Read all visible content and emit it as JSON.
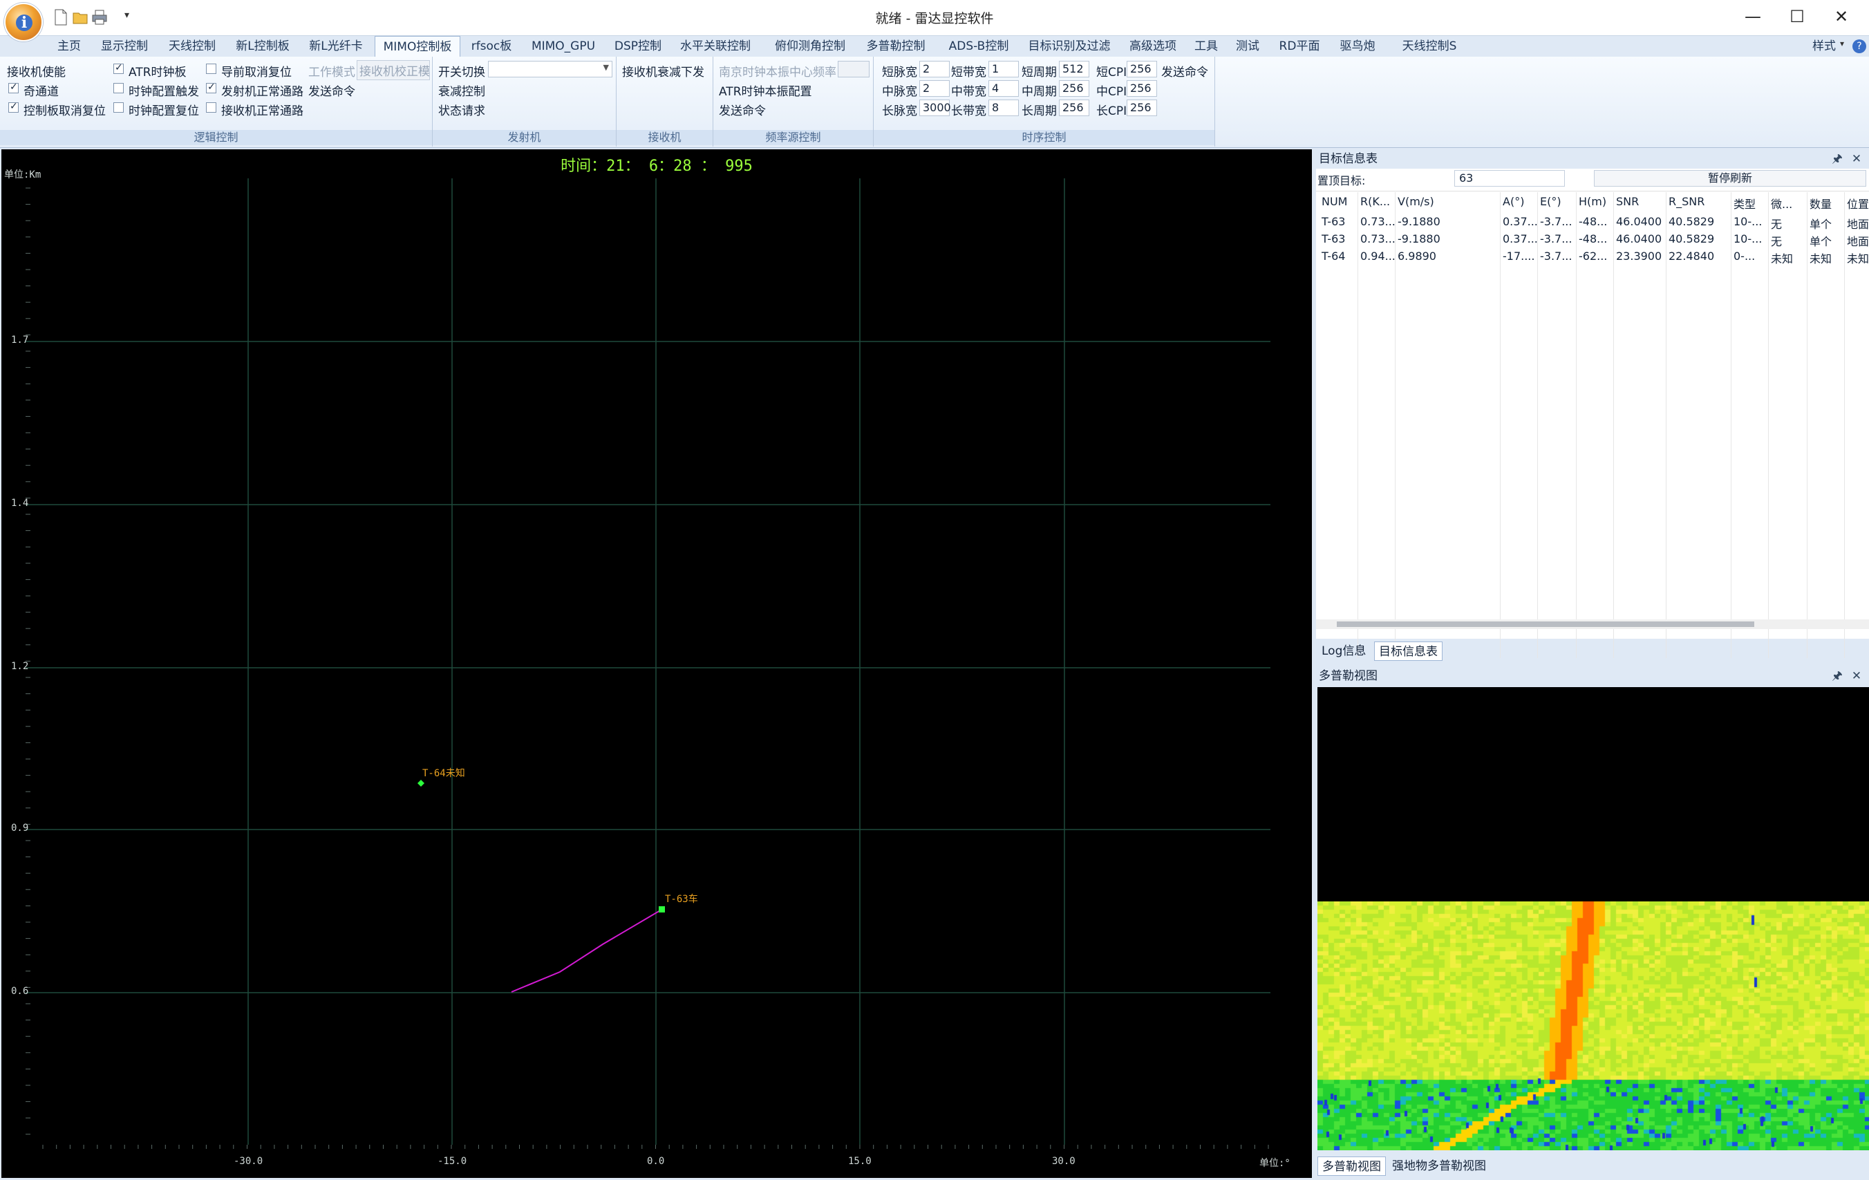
{
  "window": {
    "title": "就绪 - 雷达显控软件",
    "minimize": "—",
    "maximize": "☐",
    "close": "✕"
  },
  "tabs": [
    "主页",
    "显示控制",
    "天线控制",
    "新L控制板",
    "新L光纤卡",
    "MIMO控制板",
    "rfsoc板",
    "MIMO_GPU",
    "DSP控制",
    "水平关联控制",
    "俯仰测角控制",
    "多普勒控制",
    "ADS-B控制",
    "目标识别及过滤",
    "高级选项",
    "工具",
    "测试",
    "RD平面",
    "驱鸟炮",
    "天线控制S"
  ],
  "active_tab": "MIMO控制板",
  "style_menu": "样式",
  "ribbon": {
    "logic": {
      "label": "逻辑控制",
      "rx_enable": "接收机使能",
      "odd_channel": "奇通道",
      "ctrl_cancel_reset": "控制板取消复位",
      "atr_clock": "ATR时钟板",
      "clock_trigger": "时钟配置触发",
      "clock_reset": "时钟配置复位",
      "nav_cancel_reset": "导前取消复位",
      "tx_normal": "发射机正常通路",
      "rx_normal": "接收机正常通路",
      "work_mode": "工作模式",
      "rx_calib": "接收机校正模",
      "send_cmd": "发送命令"
    },
    "tx": {
      "label": "发射机",
      "switch": "开关切换",
      "atten": "衰减控制",
      "status": "状态请求"
    },
    "rx": {
      "label": "接收机",
      "atten_send": "接收机衰减下发"
    },
    "freq": {
      "label": "频率源控制",
      "nanjing": "南京时钟本振中心频率",
      "atr_lo": "ATR时钟本振配置",
      "send": "发送命令"
    },
    "timing": {
      "label": "时序控制",
      "short_pw": "短脉宽",
      "short_pw_v": "2",
      "mid_pw": "中脉宽",
      "mid_pw_v": "2",
      "long_pw": "长脉宽",
      "long_pw_v": "3000",
      "short_bw": "短带宽",
      "short_bw_v": "1",
      "mid_bw": "中带宽",
      "mid_bw_v": "4",
      "long_bw": "长带宽",
      "long_bw_v": "8",
      "short_pd": "短周期",
      "short_pd_v": "512",
      "mid_pd": "中周期",
      "mid_pd_v": "256",
      "long_pd": "长周期",
      "long_pd_v": "256",
      "short_cpi": "短CPI",
      "short_cpi_v": "256",
      "mid_cpi": "中CPI",
      "mid_cpi_v": "256",
      "long_cpi": "长CPI",
      "long_cpi_v": "256",
      "send": "发送命令"
    }
  },
  "radar": {
    "time": "时间：21： 6：28 ： 995",
    "unit_y": "单位:Km",
    "unit_x": "单位:°",
    "y_ticks": [
      "1.7",
      "1.4",
      "1.2",
      "0.9",
      "0.6"
    ],
    "x_ticks": [
      "-30.0",
      "-15.0",
      "0.0",
      "15.0",
      "30.0"
    ],
    "targets": [
      {
        "label": "T-64未知"
      },
      {
        "label": "T-63车"
      }
    ]
  },
  "target_table": {
    "header": "目标信息表",
    "top_label": "置顶目标:",
    "top_value": "63",
    "pause_btn": "暂停刷新",
    "columns": [
      "NUM",
      "R(K...",
      "V(m/s)",
      "A(°)",
      "E(°)",
      "H(m)",
      "SNR",
      "R_SNR",
      "类型",
      "微...",
      "数量",
      "位置"
    ],
    "rows": [
      [
        "T-63",
        "0.73...",
        "-9.1880",
        "0.37...",
        "-3.7...",
        "-48...",
        "46.0400",
        "40.5829",
        "10-...",
        "无",
        "单个",
        "地面"
      ],
      [
        "T-63",
        "0.73...",
        "-9.1880",
        "0.37...",
        "-3.7...",
        "-48...",
        "46.0400",
        "40.5829",
        "10-...",
        "无",
        "单个",
        "地面"
      ],
      [
        "T-64",
        "0.94...",
        "6.9890",
        "-17....",
        "-3.7...",
        "-62...",
        "23.3900",
        "22.4840",
        "0-...",
        "未知",
        "未知",
        "未知"
      ]
    ]
  },
  "bottom_tabs": {
    "log": "Log信息",
    "targets": "目标信息表"
  },
  "doppler": {
    "header": "多普勒视图",
    "tab1": "多普勒视图",
    "tab2": "强地物多普勒视图"
  },
  "colors": {
    "track": "#d21ad2",
    "target_label": "#e8a020",
    "grid": "#1d4a3a",
    "time_text": "#9cff3c"
  }
}
